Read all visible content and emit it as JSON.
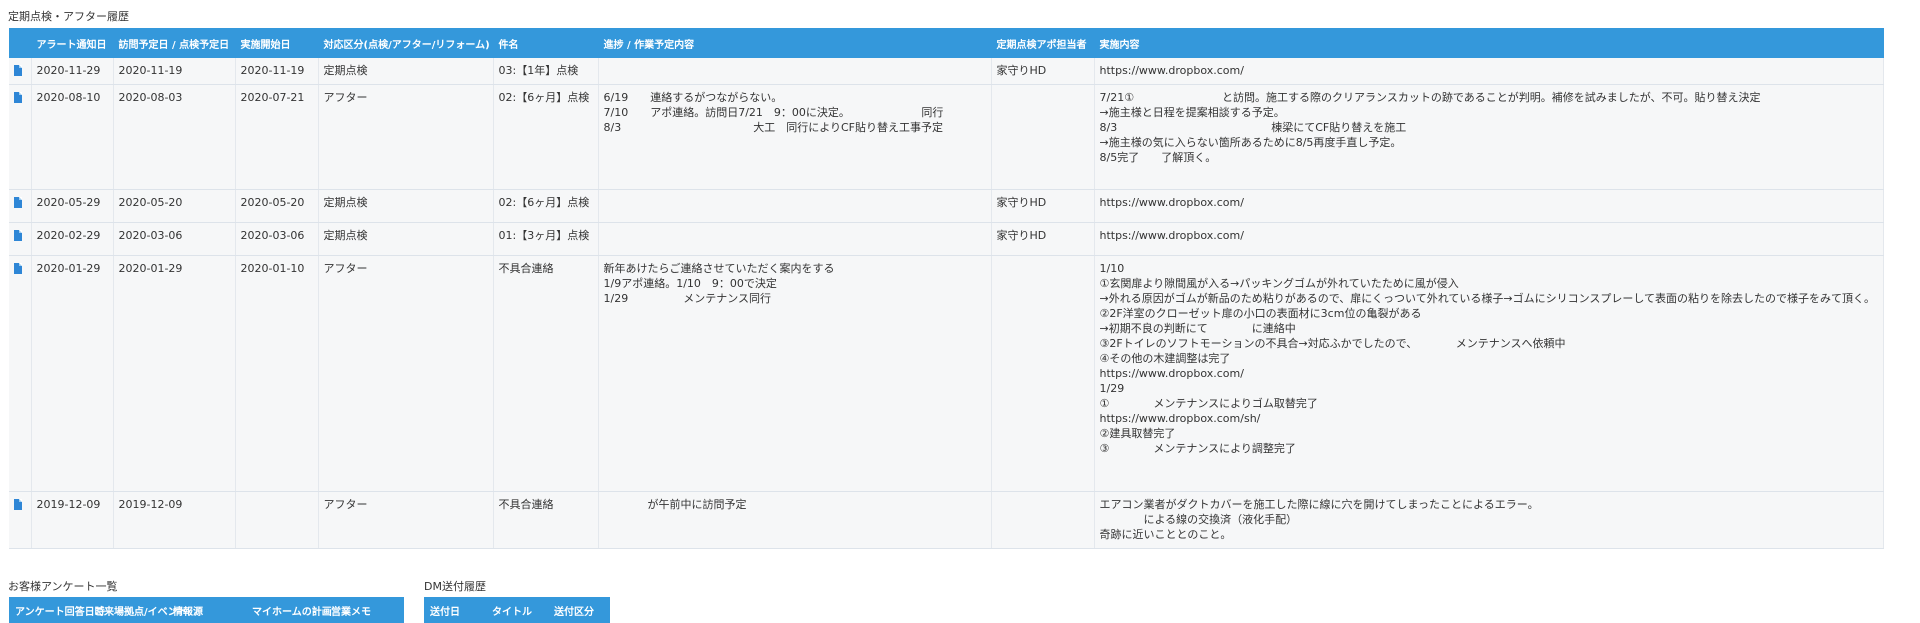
{
  "history": {
    "title": "定期点検・アフター履歴",
    "columns": [
      "",
      "アラート通知日",
      "訪問予定日 / 点検予定日",
      "実施開始日",
      "対応区分(点検/アフター/リフォーム)",
      "件名",
      "進捗 / 作業予定内容",
      "定期点検アポ担当者",
      "実施内容"
    ],
    "rows": [
      {
        "alert": "2020-11-29",
        "visit": "2020-11-19",
        "start": "2020-11-19",
        "type": "定期点検",
        "subject": "03:【1年】点検",
        "progress": "",
        "staff": "家守りHD",
        "detail": "https://www.dropbox.com/"
      },
      {
        "alert": "2020-08-10",
        "visit": "2020-08-03",
        "start": "2020-07-21",
        "type": "アフター",
        "subject": "02:【6ヶ月】点検",
        "progress": "6/19　　連絡するがつながらない。\n7/10　　アポ連絡。訪問日7/21　9：00に決定。　　　　　　　同行\n8/3　　　　　　　　　　　　大工　同行によりCF貼り替え工事予定",
        "staff": "",
        "detail": "7/21①　　　　　　　　と訪問。施工する際のクリアランスカットの跡であることが判明。補修を試みましたが、不可。貼り替え決定\n→施主様と日程を提案相談する予定。\n8/3　　　　　　　　　　　　　　棟梁にてCF貼り替えを施工\n→施主様の気に入らない箇所あるために8/5再度手直し予定。\n8/5完了　　了解頂く。"
      },
      {
        "alert": "2020-05-29",
        "visit": "2020-05-20",
        "start": "2020-05-20",
        "type": "定期点検",
        "subject": "02:【6ヶ月】点検",
        "progress": "",
        "staff": "家守りHD",
        "detail": "https://www.dropbox.com/"
      },
      {
        "alert": "2020-02-29",
        "visit": "2020-03-06",
        "start": "2020-03-06",
        "type": "定期点検",
        "subject": "01:【3ヶ月】点検",
        "progress": "",
        "staff": "家守りHD",
        "detail": "https://www.dropbox.com/"
      },
      {
        "alert": "2020-01-29",
        "visit": "2020-01-29",
        "start": "2020-01-10",
        "type": "アフター",
        "subject": "不具合連絡",
        "progress": "新年あけたらご連絡させていただく案内をする\n1/9アポ連絡。1/10　9：00で決定\n1/29　　　　　メンテナンス同行",
        "staff": "",
        "detail": "1/10\n①玄関扉より隙間風が入る→パッキングゴムが外れていたために風が侵入\n→外れる原因がゴムが新品のため粘りがあるので、扉にくっついて外れている様子→ゴムにシリコンスプレーして表面の粘りを除去したので様子をみて頂く。\n②2F洋室のクローゼット扉の小口の表面材に3cm位の亀裂がある\n→初期不良の判断にて　　　　に連絡中\n③2Fトイレのソフトモーションの不具合→対応ふかでしたので、　　　　メンテナンスへ依頼中\n④その他の木建調整は完了\nhttps://www.dropbox.com/\n1/29\n①　　　　メンテナンスによりゴム取替完了\nhttps://www.dropbox.com/sh/\n②建具取替完了\n③　　　　メンテナンスにより調整完了"
      },
      {
        "alert": "2019-12-09",
        "visit": "2019-12-09",
        "start": "",
        "type": "アフター",
        "subject": "不具合連絡",
        "progress": "　　　　が午前中に訪問予定",
        "staff": "",
        "detail": "エアコン業者がダクトカバーを施工した際に線に穴を開けてしまったことによるエラー。\n　　　　による線の交換済（液化手配）\n奇跡に近いこととのこと。"
      }
    ]
  },
  "survey": {
    "title": "お客様アンケート一覧",
    "columns": [
      "アンケート回答日時",
      "ご来場拠点/イベント",
      "情報源",
      "マイホームの計画",
      "営業メモ"
    ]
  },
  "dm": {
    "title": "DM送付履歴",
    "columns": [
      "送付日",
      "タイトル",
      "送付区分"
    ]
  },
  "icons": {
    "row_icon": "document-icon"
  },
  "colors": {
    "header": "#3498db",
    "link": "#3a8fd8"
  }
}
